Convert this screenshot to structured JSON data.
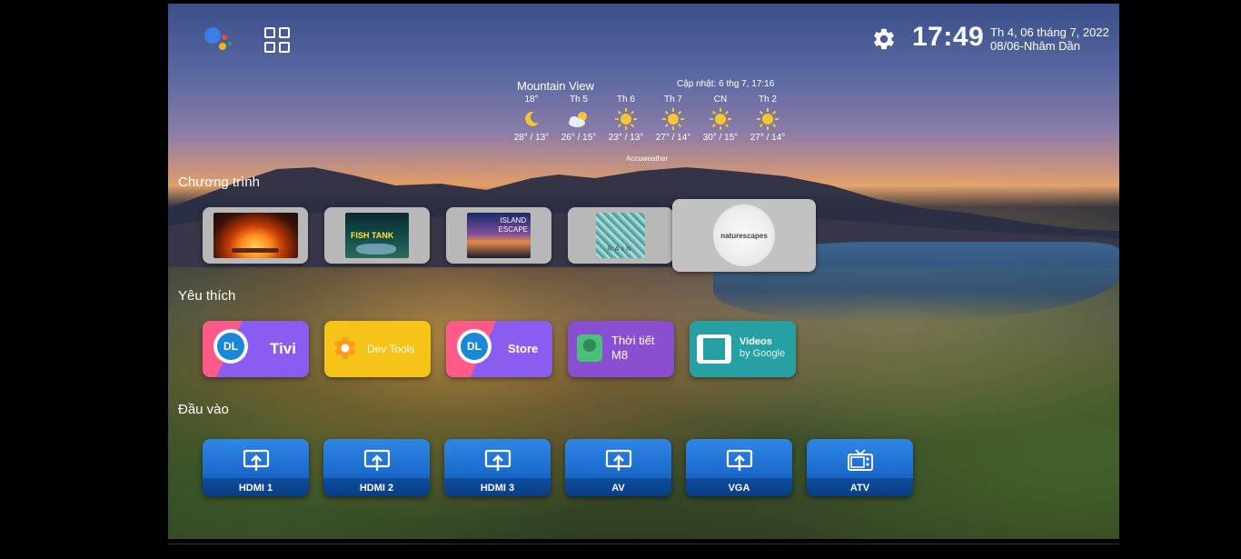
{
  "top": {
    "time": "17:49",
    "date_line1": "Th 4, 06 tháng 7, 2022",
    "date_line2": "08/06-Nhâm Dần",
    "icons": [
      "google-assistant-icon",
      "apps-grid-icon",
      "settings-gear-icon"
    ]
  },
  "weather": {
    "city": "Mountain View",
    "updated": "Cập nhật: 6 thg 7, 17:16",
    "source": "Accuweather",
    "days": [
      {
        "name": "18°",
        "icon": "moon",
        "temp": "28° / 13°"
      },
      {
        "name": "Th 5",
        "icon": "partly-cloudy",
        "temp": "26° / 15°"
      },
      {
        "name": "Th 6",
        "icon": "sun",
        "temp": "23° / 13°"
      },
      {
        "name": "Th 7",
        "icon": "sun",
        "temp": "27° / 14°"
      },
      {
        "name": "CN",
        "icon": "sun",
        "temp": "30° / 15°"
      },
      {
        "name": "Th 2",
        "icon": "sun",
        "temp": "27° / 14°"
      }
    ]
  },
  "sections": {
    "programs": "Chương trình",
    "favorites": "Yêu thích",
    "inputs": "Đầu vào"
  },
  "programs": [
    {
      "name": "fireplace"
    },
    {
      "name": "fish-tank",
      "label": "FISH TANK"
    },
    {
      "name": "island-escape",
      "label_1": "ISLAND",
      "label_2": "ESCAPE"
    },
    {
      "name": "rain",
      "label": "RAIN"
    },
    {
      "name": "naturescapes",
      "label": "naturescapes"
    }
  ],
  "favorites": [
    {
      "label": "Tivi",
      "badge": "DL",
      "color_from": "#8a5cf0",
      "color_to": "#ff5a8a"
    },
    {
      "label": "Dev Tools",
      "color": "#f6c318"
    },
    {
      "label": "Store",
      "badge": "DL",
      "color_from": "#ff5a8a",
      "color_to": "#8a5cf0"
    },
    {
      "label_1": "Thời tiết",
      "label_2": "M8",
      "color": "#8a4fd0"
    },
    {
      "label_1": "Videos",
      "label_2": "by Google",
      "color": "#27a0a4"
    }
  ],
  "inputs": [
    {
      "label": "HDMI 1",
      "icon": "cast-input-icon"
    },
    {
      "label": "HDMI 2",
      "icon": "cast-input-icon"
    },
    {
      "label": "HDMI 3",
      "icon": "cast-input-icon"
    },
    {
      "label": "AV",
      "icon": "cast-input-icon"
    },
    {
      "label": "VGA",
      "icon": "cast-input-icon"
    },
    {
      "label": "ATV",
      "icon": "tv-icon"
    }
  ]
}
